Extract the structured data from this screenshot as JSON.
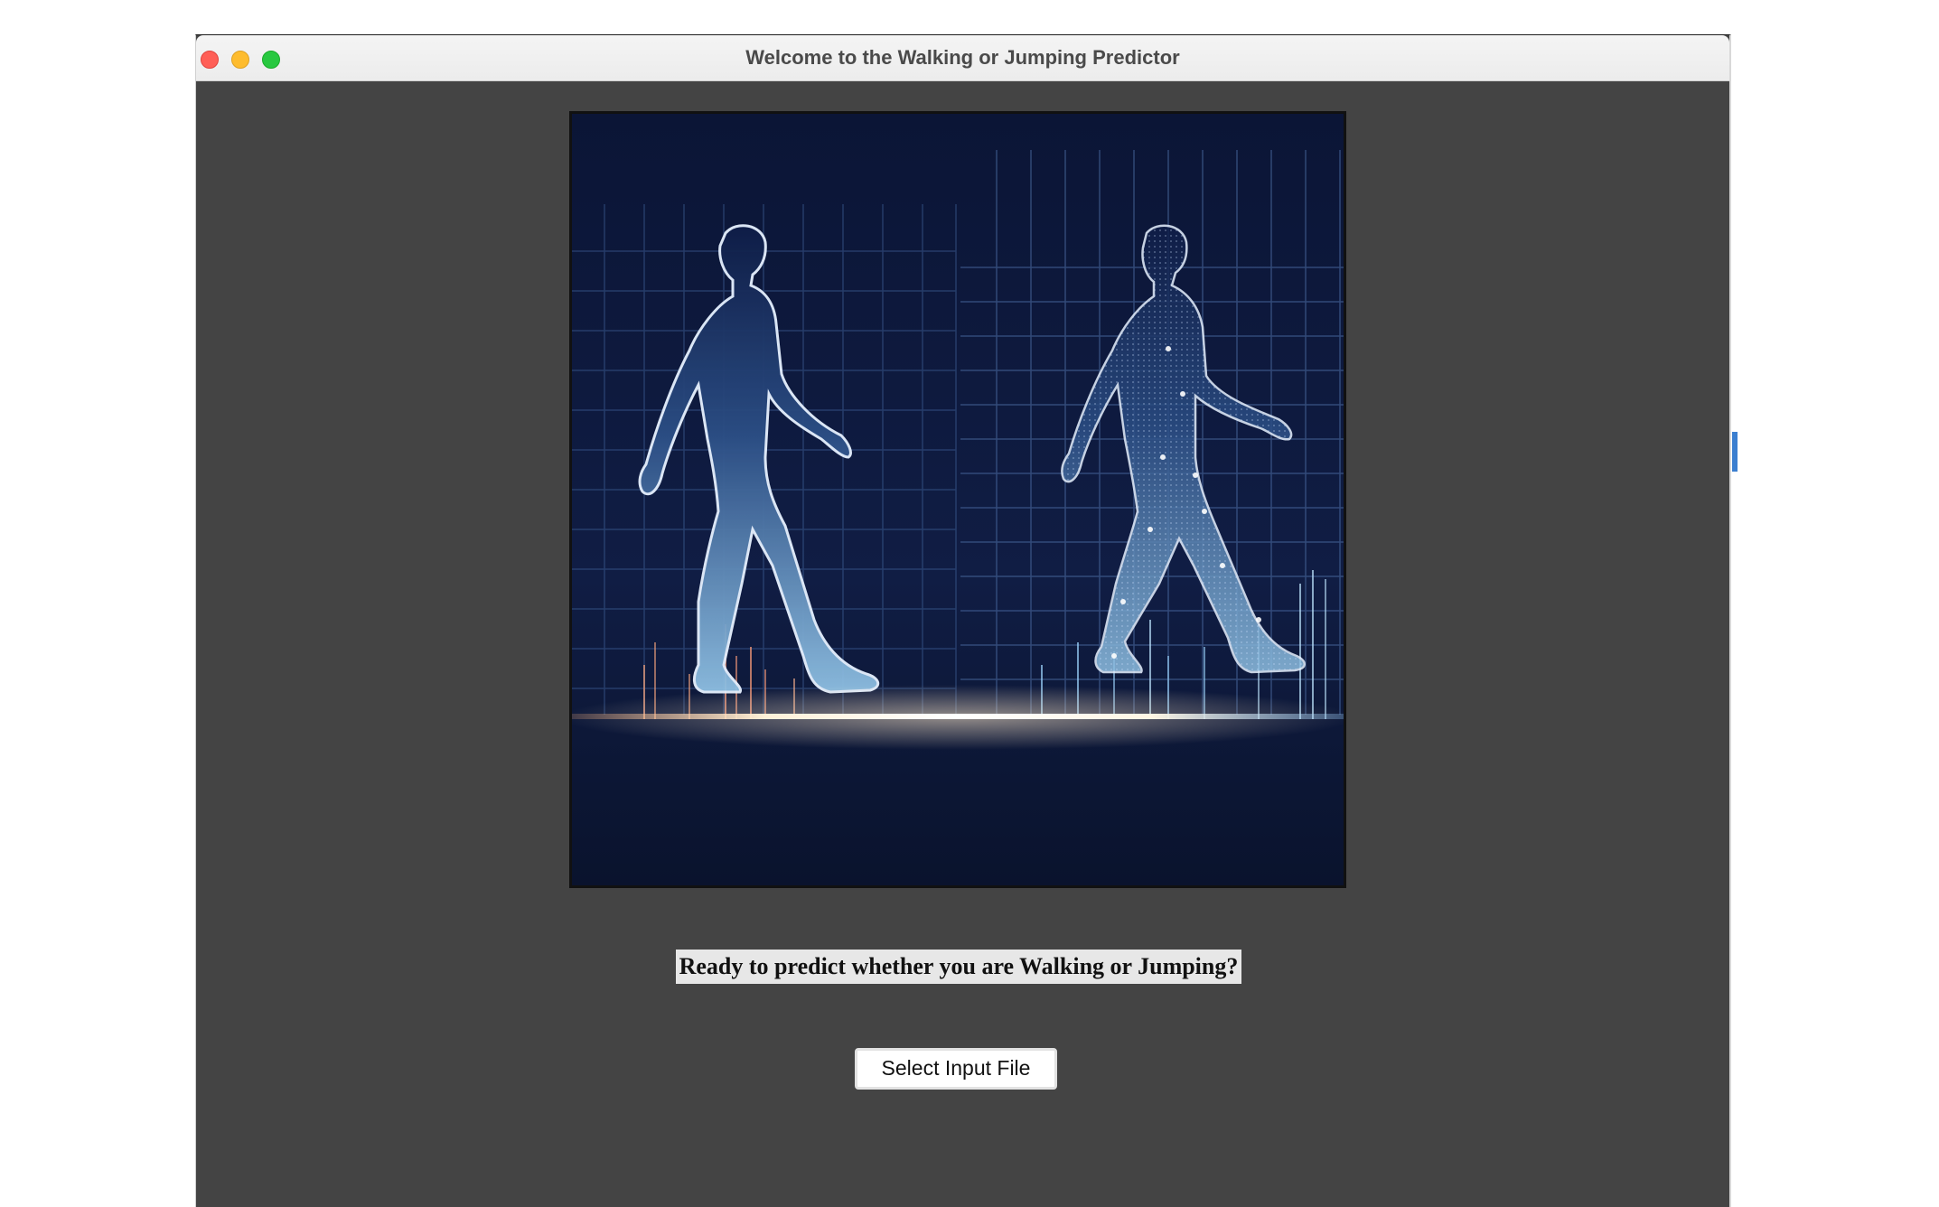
{
  "window": {
    "title": "Welcome to the Walking or Jumping Predictor"
  },
  "main": {
    "hero_image": {
      "description_icon": "walking-figures-illustration-icon"
    },
    "prompt_text": "Ready to predict whether you are Walking or Jumping?",
    "select_button_label": "Select Input File"
  },
  "colors": {
    "window_bg": "#444444",
    "hero_bg": "#0b1635",
    "grid_line": "#3b5a8f",
    "figure_glow": "#cfe3ff",
    "floor_glow": "#fff2d6"
  }
}
